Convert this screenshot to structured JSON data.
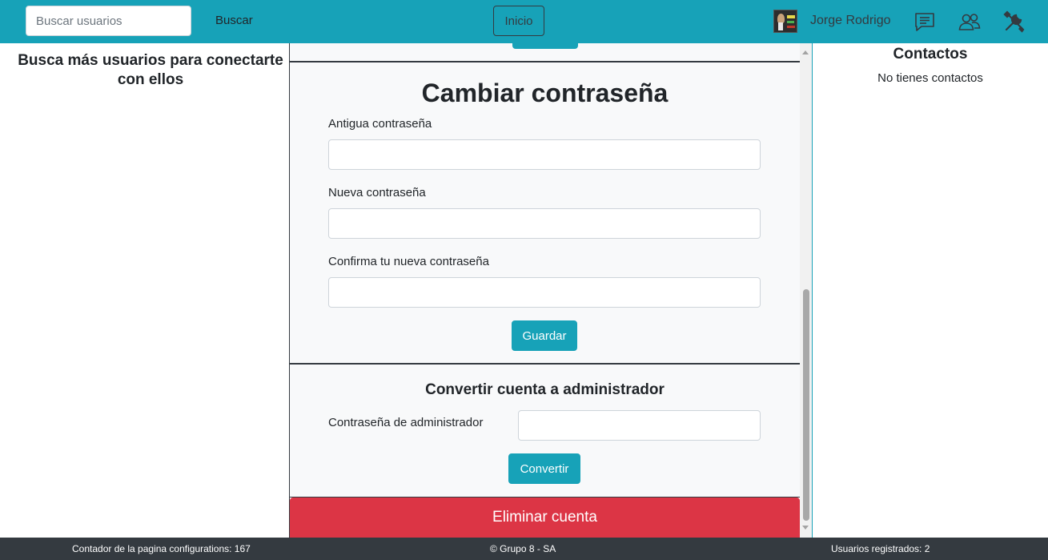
{
  "topbar": {
    "search_placeholder": "Buscar usuarios",
    "search_button": "Buscar",
    "home_button": "Inicio",
    "user_name": "Jorge Rodrigo",
    "icons": [
      "chat-icon",
      "users-icon",
      "tools-icon"
    ]
  },
  "left": {
    "title": "Busca más usuarios para conectarte con ellos"
  },
  "password_section": {
    "title": "Cambiar contraseña",
    "old_label": "Antigua contraseña",
    "new_label": "Nueva contraseña",
    "confirm_label": "Confirma tu nueva contraseña",
    "save_button": "Guardar"
  },
  "admin_section": {
    "title": "Convertir cuenta a administrador",
    "password_label": "Contraseña de administrador",
    "convert_button": "Convertir"
  },
  "delete_button": "Eliminar cuenta",
  "right": {
    "title": "Contactos",
    "empty_text": "No tienes contactos"
  },
  "footer": {
    "counter": "Contador de la pagina configurations: 167",
    "copyright": "© Grupo 8 - SA",
    "registered": "Usuarios registrados: 2"
  },
  "colors": {
    "topbar": "#17a2b8",
    "info_button": "#17a2b8",
    "danger_button": "#dc3545",
    "footer": "#343a40",
    "panel_bg": "#f8f9fa"
  }
}
